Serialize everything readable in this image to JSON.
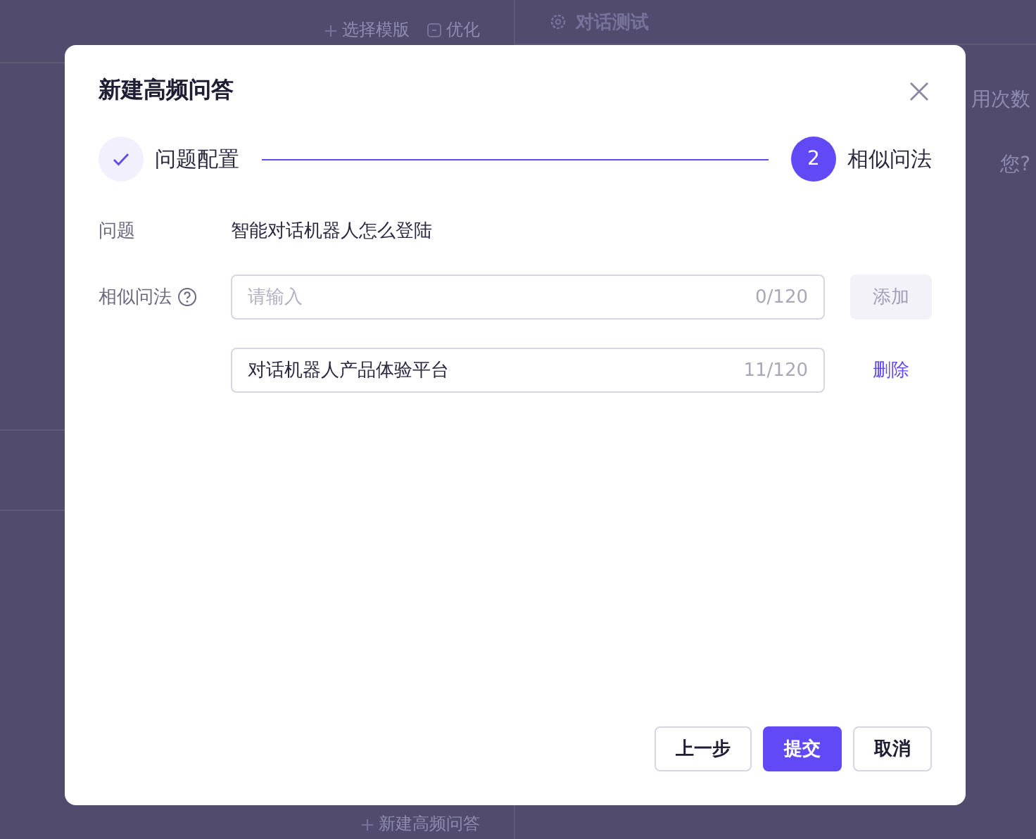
{
  "background": {
    "editor_actions": [
      {
        "kind": "plus",
        "label": "选择模版"
      },
      {
        "kind": "magic",
        "label": "优化"
      }
    ],
    "test_panel": {
      "title": "对话测试",
      "column_text": "用次数",
      "chat_text": "您?"
    },
    "add_link": "新建高频问答"
  },
  "dialog": {
    "title": "新建高频问答",
    "steps": [
      {
        "completed": true,
        "label": "问题配置"
      },
      {
        "completed": false,
        "number": "2",
        "label": "相似问法"
      }
    ],
    "question": {
      "label": "问题",
      "value": "智能对话机器人怎么登陆"
    },
    "similar": {
      "label": "相似问法",
      "input": {
        "placeholder": "请输入",
        "counter": "0/120"
      },
      "add_button": {
        "label": "添加",
        "disabled": true
      },
      "items": [
        {
          "value": "对话机器人产品体验平台",
          "counter": "11/120",
          "action": "删除"
        }
      ]
    },
    "buttons": [
      {
        "label": "上一步",
        "kind": "default"
      },
      {
        "label": "提交",
        "kind": "primary"
      },
      {
        "label": "取消",
        "kind": "default"
      }
    ]
  }
}
